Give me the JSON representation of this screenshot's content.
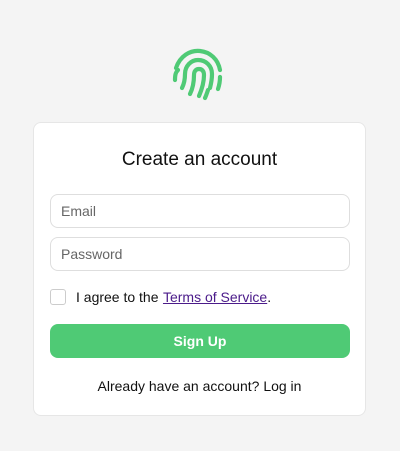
{
  "logo": {
    "icon": "fingerprint-icon",
    "color": "#4fca75"
  },
  "form": {
    "title": "Create an account",
    "email_placeholder": "Email",
    "password_placeholder": "Password",
    "agree_prefix": "I agree to the ",
    "terms_link": "Terms of Service",
    "agree_suffix": ".",
    "submit_label": "Sign Up",
    "login_prompt": "Already have an account? ",
    "login_link": "Log in"
  },
  "colors": {
    "accent": "#4fca75",
    "link": "#4b1b8a",
    "background": "#f4f4f4"
  }
}
